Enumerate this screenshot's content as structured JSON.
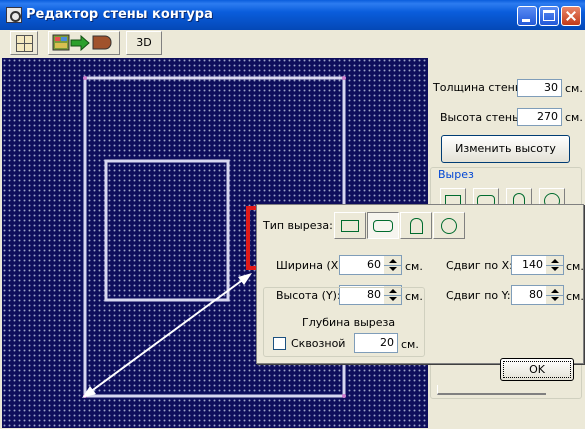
{
  "window": {
    "title": "Редактор стены контура"
  },
  "toolbar": {
    "view_3d_label": "3D"
  },
  "properties": {
    "wall_thickness_label": "Толщина стены",
    "wall_thickness_value": "30",
    "wall_thickness_unit": "см.",
    "wall_height_label": "Высота стены",
    "wall_height_value": "270",
    "wall_height_unit": "см.",
    "change_height_button": "Изменить высоту",
    "cutout_group_label": "Вырез"
  },
  "cutout_dialog": {
    "type_label": "Тип выреза:",
    "width_label": "Ширина (X):",
    "width_value": "60",
    "width_unit": "см.",
    "height_label": "Высота (Y):",
    "height_value": "80",
    "height_unit": "см.",
    "offset_x_label": "Сдвиг по X:",
    "offset_x_value": "140",
    "offset_x_unit": "см.",
    "offset_y_label": "Сдвиг по Y:",
    "offset_y_value": "80",
    "offset_y_unit": "см.",
    "depth_group_label": "Глубина выреза",
    "through_label": "Сквозной",
    "through_checked": false,
    "depth_value": "20",
    "depth_unit": "см.",
    "ok_button": "OK"
  },
  "colors": {
    "canvas_bg": "#0e0e5c",
    "wall_line": "#d8d8f0",
    "cutout_highlight": "#e01a1a",
    "shape_icon": "#006b2e"
  },
  "icons": [
    "app-icon",
    "grid-icon",
    "import-wall-icon",
    "rectangle-icon",
    "rounded-rectangle-icon",
    "arch-icon",
    "circle-icon"
  ]
}
